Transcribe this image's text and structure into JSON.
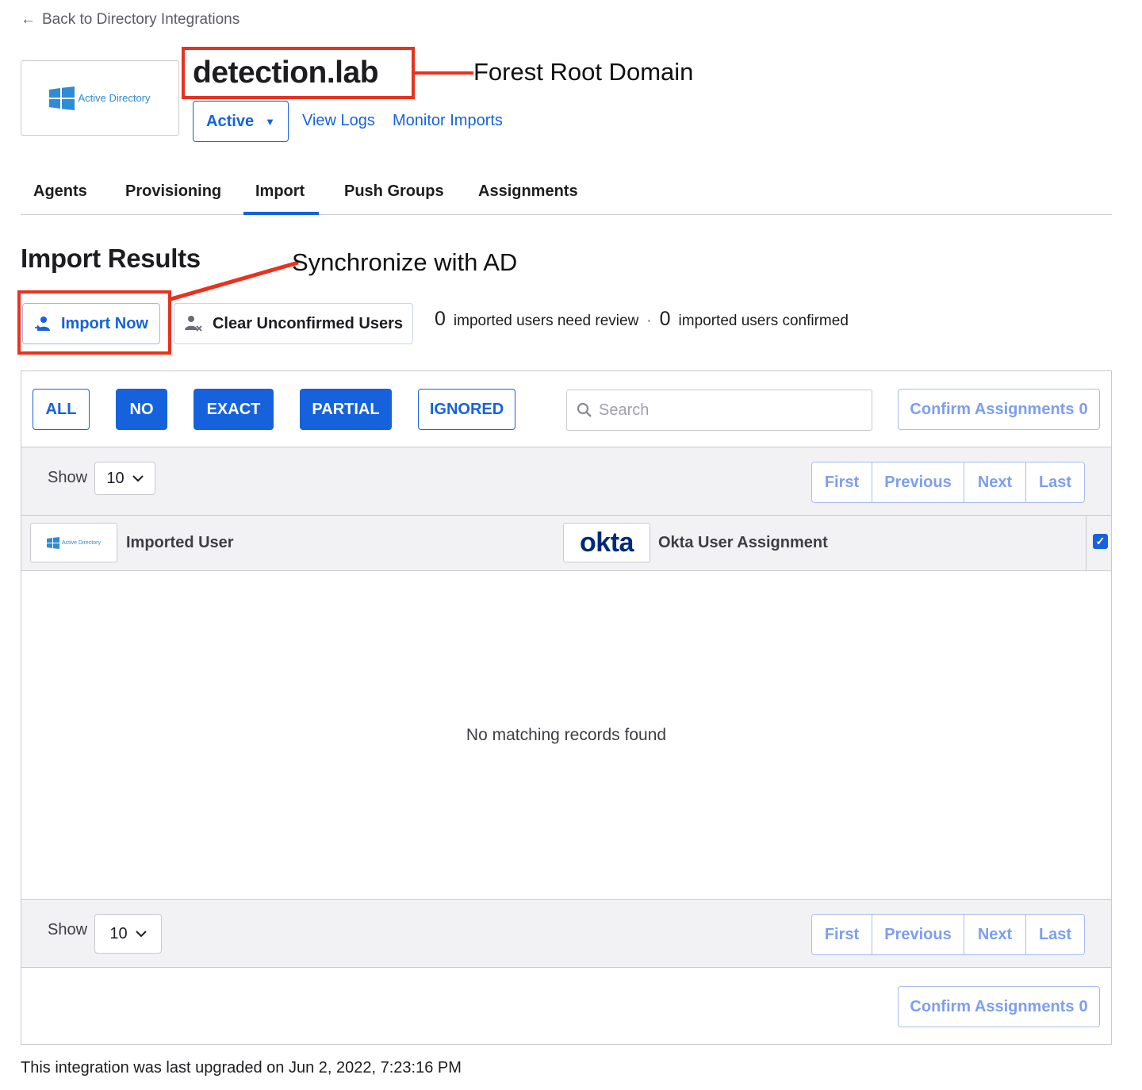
{
  "nav": {
    "back_label": "Back to Directory Integrations"
  },
  "integration": {
    "logo_text": "Active Directory",
    "title": "detection.lab",
    "status": "Active",
    "links": [
      "View Logs",
      "Monitor Imports"
    ]
  },
  "annotations": {
    "forest_root": "Forest Root Domain",
    "synchronize": "Synchronize with AD"
  },
  "tabs": [
    {
      "label": "Agents"
    },
    {
      "label": "Provisioning"
    },
    {
      "label": "Import",
      "active": true
    },
    {
      "label": "Push Groups"
    },
    {
      "label": "Assignments"
    }
  ],
  "import_results": {
    "title": "Import Results",
    "import_now_label": "Import Now",
    "clear_label": "Clear Unconfirmed Users",
    "review_count": "0",
    "review_label": "imported users need review",
    "separator": "·",
    "confirmed_count": "0",
    "confirmed_label": "imported users confirmed"
  },
  "filters": [
    {
      "label": "ALL",
      "style": "outline"
    },
    {
      "label": "NO",
      "style": "solid"
    },
    {
      "label": "EXACT",
      "style": "solid"
    },
    {
      "label": "PARTIAL",
      "style": "solid"
    },
    {
      "label": "IGNORED",
      "style": "outline"
    }
  ],
  "search": {
    "placeholder": "Search",
    "value": ""
  },
  "confirm": {
    "label": "Confirm Assignments",
    "count": "0"
  },
  "pagination": {
    "show_label": "Show",
    "page_size": "10",
    "buttons": [
      "First",
      "Previous",
      "Next",
      "Last"
    ]
  },
  "table": {
    "col_imported": "Imported User",
    "okta_logo": "okta",
    "col_assignment": "Okta User Assignment",
    "select_all_checked": true,
    "empty_message": "No matching records found"
  },
  "footer": {
    "text": "This integration was last upgraded on Jun 2, 2022, 7:23:16 PM"
  },
  "colors": {
    "primary": "#1662dd",
    "annotation": "#e8321f",
    "okta": "#00297a",
    "ad_blue": "#2e8bd6"
  }
}
